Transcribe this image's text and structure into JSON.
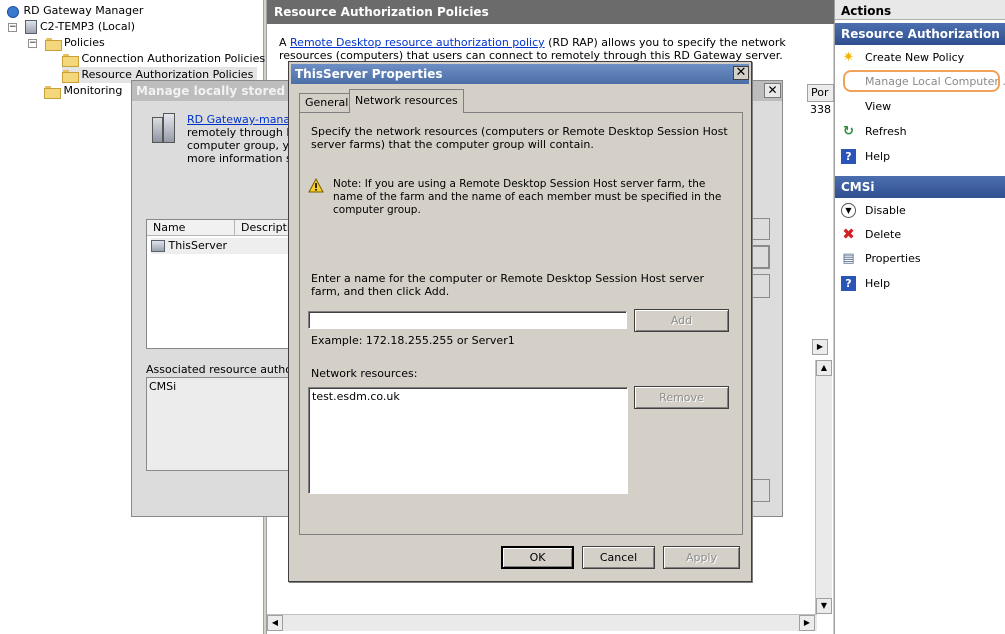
{
  "tree": {
    "root": "RD Gateway Manager",
    "server": "C2-TEMP3 (Local)",
    "policies": "Policies",
    "cap": "Connection Authorization Policies",
    "rap": "Resource Authorization Policies",
    "monitoring": "Monitoring",
    "exp_minus": "−"
  },
  "middle": {
    "title": "Resource Authorization Policies",
    "desc_prefix": "A ",
    "desc_link": "Remote Desktop resource authorization policy",
    "desc_suffix": " (RD RAP) allows you to specify the network resources (computers) that users can connect to remotely through this RD Gateway server.",
    "col_header": "Por",
    "col_value": "338"
  },
  "bg_dialog": {
    "title": "Manage locally stored computer groups",
    "link": "RD Gateway-manage",
    "line2": "remotely through RD",
    "line3": "computer group, you",
    "line4": "more information see",
    "col_name": "Name",
    "col_desc": "Description",
    "row_server": "ThisServer",
    "assoc_label": "Associated resource authorization policies:",
    "assoc_value": "CMSi",
    "close": "✕"
  },
  "dialog": {
    "title": "ThisServer Properties",
    "close": "✕",
    "tab_general": "General",
    "tab_network": "Network resources",
    "intro": "Specify the network resources (computers or Remote Desktop Session Host server farms) that the computer group will contain.",
    "note": "Note: If you are using a Remote Desktop Session Host server farm, the name of the farm and the name of each member must be specified in the computer group.",
    "enter_label": "Enter a name for the computer or Remote Desktop Session Host server farm, and then click Add.",
    "input_value": "",
    "add": "Add",
    "example": "Example: 172.18.255.255 or Server1",
    "resources_label": "Network resources:",
    "resource_item": "test.esdm.co.uk",
    "remove": "Remove",
    "ok": "OK",
    "cancel": "Cancel",
    "apply": "Apply"
  },
  "actions": {
    "title": "Actions",
    "section1": "Resource Authorization P...",
    "create": "Create New Policy",
    "manage": "Manage Local Computer ...",
    "view": "View",
    "refresh": "Refresh",
    "help": "Help",
    "section2": "CMSi",
    "disable": "Disable",
    "delete": "Delete",
    "properties": "Properties",
    "help2": "Help"
  },
  "icons": {
    "star": "✷",
    "refresh": "↻",
    "help": "?",
    "disable": "▼",
    "delete": "✖",
    "properties": "▤",
    "scroll_up": "▲",
    "scroll_down": "▼",
    "scroll_left": "◀",
    "scroll_right": "▶"
  },
  "colors": {
    "accent": "#4b6ea6",
    "highlight_outline": "#f0a25a",
    "delete_red": "#d42020",
    "help_blue": "#2a55b8"
  }
}
